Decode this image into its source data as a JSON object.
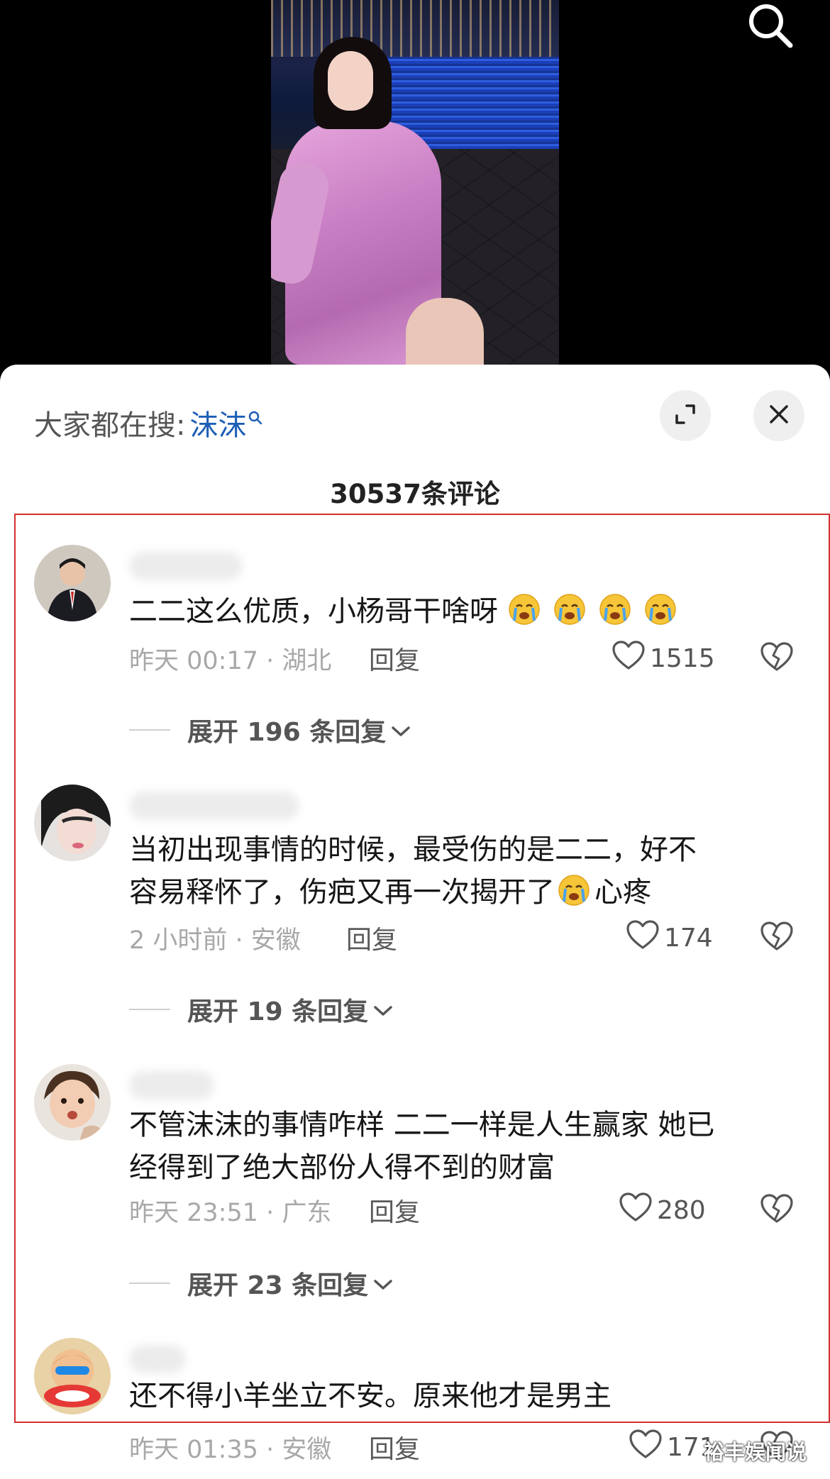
{
  "video": {
    "search_icon": "search-icon"
  },
  "header": {
    "search_label": "大家都在搜:",
    "search_keyword": "沫沫",
    "expand_icon": "expand-icon",
    "close_icon": "close-icon",
    "comment_count": "30537条评论"
  },
  "comments": [
    {
      "text": "二二这么优质，小杨哥干啥呀",
      "emoji": "crying-face-emoji",
      "time_location": "昨天 00:17 · 湖北",
      "reply_label": "回复",
      "likes": "1515",
      "expand_label": "展开 196 条回复"
    },
    {
      "text_line1": "当初出现事情的时候，最受伤的是二二，好不",
      "text_line2_a": "容易释怀了，伤疤又再一次揭开了",
      "text_line2_b": "心疼",
      "emoji": "crying-face-emoji",
      "time_location": "2 小时前 · 安徽",
      "reply_label": "回复",
      "likes": "174",
      "expand_label": "展开 19 条回复"
    },
    {
      "text_line1": "不管沫沫的事情咋样 二二一样是人生赢家 她已",
      "text_line2": "经得到了绝大部份人得不到的财富",
      "time_location": "昨天 23:51 · 广东",
      "reply_label": "回复",
      "likes": "280",
      "expand_label": "展开 23 条回复"
    },
    {
      "text": "还不得小羊坐立不安。原来他才是男主",
      "time_location": "昨天 01:35 · 安徽",
      "reply_label": "回复",
      "likes": "171"
    }
  ],
  "watermark": "裕丰娱闻说",
  "colors": {
    "keyword": "#1d5fb7",
    "highlight_box": "#d32f2f"
  }
}
